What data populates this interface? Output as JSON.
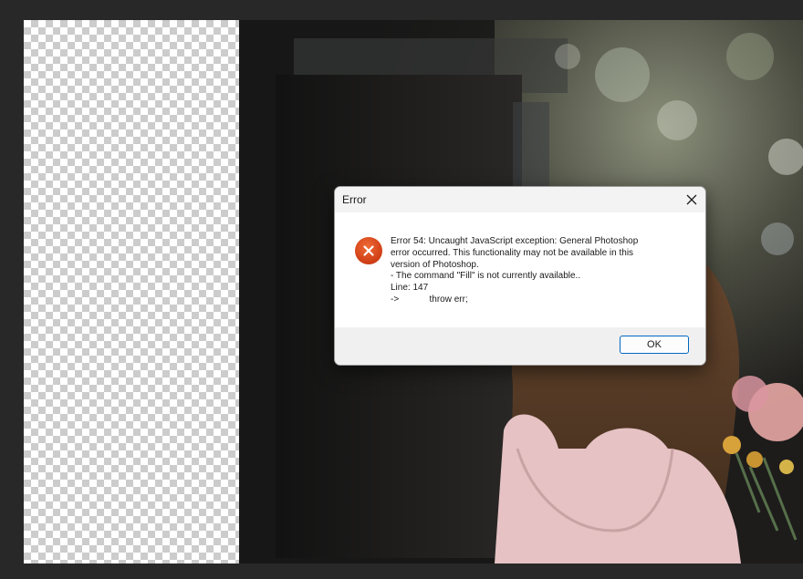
{
  "dialog": {
    "title": "Error",
    "close_icon": "close-icon",
    "error_icon": "error-x-circle-icon",
    "message_lines": [
      "Error 54: Uncaught JavaScript exception: General Photoshop",
      "error occurred. This functionality may not be available in this",
      "version of Photoshop.",
      "- The command \"Fill\" is not currently available..",
      "Line: 147",
      "->            throw err;"
    ],
    "ok_label": "OK"
  },
  "colors": {
    "workspace_bg": "#282828",
    "error_icon": "#d84315",
    "ok_border": "#0067c0"
  }
}
